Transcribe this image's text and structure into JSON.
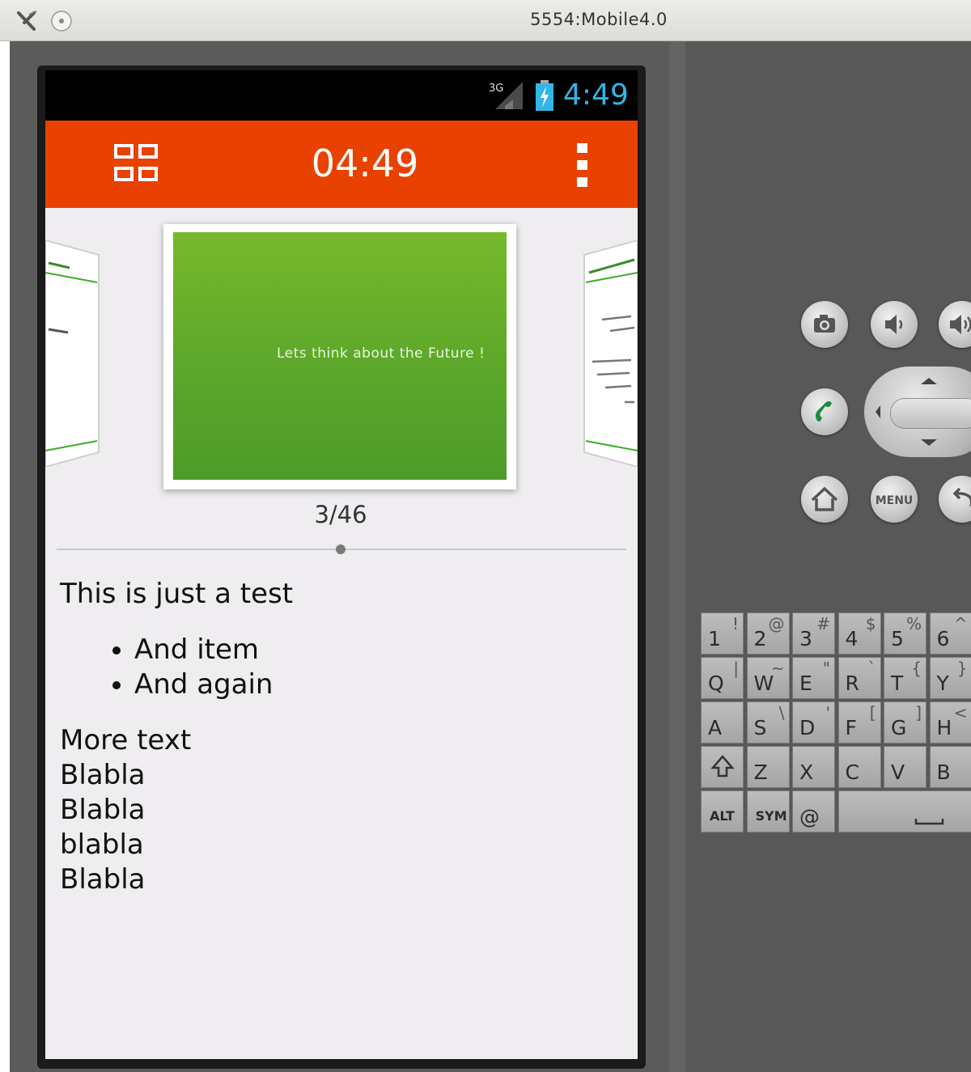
{
  "window": {
    "title": "5554:Mobile4.0"
  },
  "colors": {
    "accent": "#e84100",
    "slide_green": "#5ca72a",
    "clock_blue": "#33b5e5"
  },
  "status_bar": {
    "network": "3G",
    "time": "4:49"
  },
  "action_bar": {
    "timer": "04:49",
    "icons": [
      "grid-icon",
      "overflow-menu-icon"
    ]
  },
  "slides": {
    "current_slide_text": "Lets think about the Future !",
    "counter": "3/46"
  },
  "notes": {
    "heading": "This is just a test",
    "bullets": [
      "And item",
      "And again"
    ],
    "lines": [
      "More text",
      "Blabla",
      "Blabla",
      "blabla",
      "Blabla"
    ]
  },
  "hardware": {
    "menu_label": "MENU",
    "keyboard": {
      "row1": [
        [
          "1",
          "!"
        ],
        [
          "2",
          "@"
        ],
        [
          "3",
          "#"
        ],
        [
          "4",
          "$"
        ],
        [
          "5",
          "%"
        ],
        [
          "6",
          "^"
        ]
      ],
      "row2": [
        [
          "Q",
          "|"
        ],
        [
          "W",
          "~"
        ],
        [
          "E",
          "\""
        ],
        [
          "R",
          "`"
        ],
        [
          "T",
          "{"
        ],
        [
          "Y",
          "}"
        ]
      ],
      "row3": [
        [
          "A",
          ""
        ],
        [
          "S",
          "\\"
        ],
        [
          "D",
          "'"
        ],
        [
          "F",
          "["
        ],
        [
          "G",
          "]"
        ],
        [
          "H",
          "<"
        ]
      ],
      "row4": [
        [
          "",
          ""
        ],
        [
          "Z",
          ""
        ],
        [
          "X",
          ""
        ],
        [
          "C",
          ""
        ],
        [
          "V",
          ""
        ],
        [
          "B",
          ""
        ]
      ],
      "row5": [
        "ALT",
        "SYM",
        "@"
      ]
    }
  }
}
